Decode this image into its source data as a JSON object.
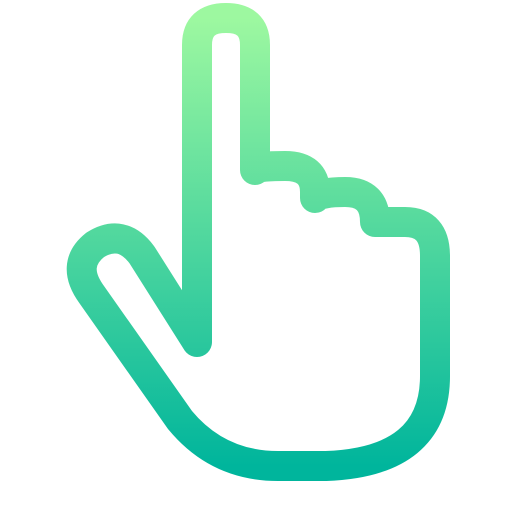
{
  "icon": {
    "name": "pointing-hand-icon",
    "gradient_top_color": "#9DF8A0",
    "gradient_bottom_color": "#00B59C",
    "background_color": "#FFFFFF"
  }
}
